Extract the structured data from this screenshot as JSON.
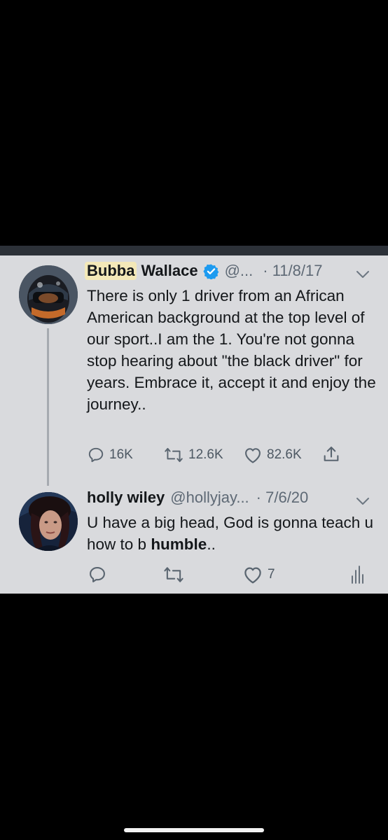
{
  "tweets": [
    {
      "name_highlight": "Bubba",
      "name_rest": "Wallace",
      "handle": "@...",
      "date": "· 11/8/17",
      "text": "There is only 1 driver from an African American background at the top level of our sport..I am the 1. You're not gonna stop hearing about \"the black driver\" for years. Embrace it, accept it and enjoy the journey..",
      "replies": "16K",
      "retweets": "12.6K",
      "likes": "82.6K"
    },
    {
      "name": "holly wiley",
      "handle": "@hollyjay...",
      "date": "· 7/6/20",
      "text_before": "U have a big head, God is gonna teach u how to b ",
      "text_bold": "humble",
      "text_after": "..",
      "replies": "",
      "retweets": "",
      "likes": "7"
    }
  ],
  "icons": [
    "verified-badge-icon",
    "chevron-down-icon",
    "reply-icon",
    "retweet-icon",
    "like-icon",
    "share-icon",
    "analytics-icon"
  ],
  "colors": {
    "background": "#000000",
    "card": "#d9dadd",
    "verified": "#1d9bf0",
    "highlight": "#f3e8b8",
    "text": "#14171a",
    "muted": "#5e6975"
  }
}
